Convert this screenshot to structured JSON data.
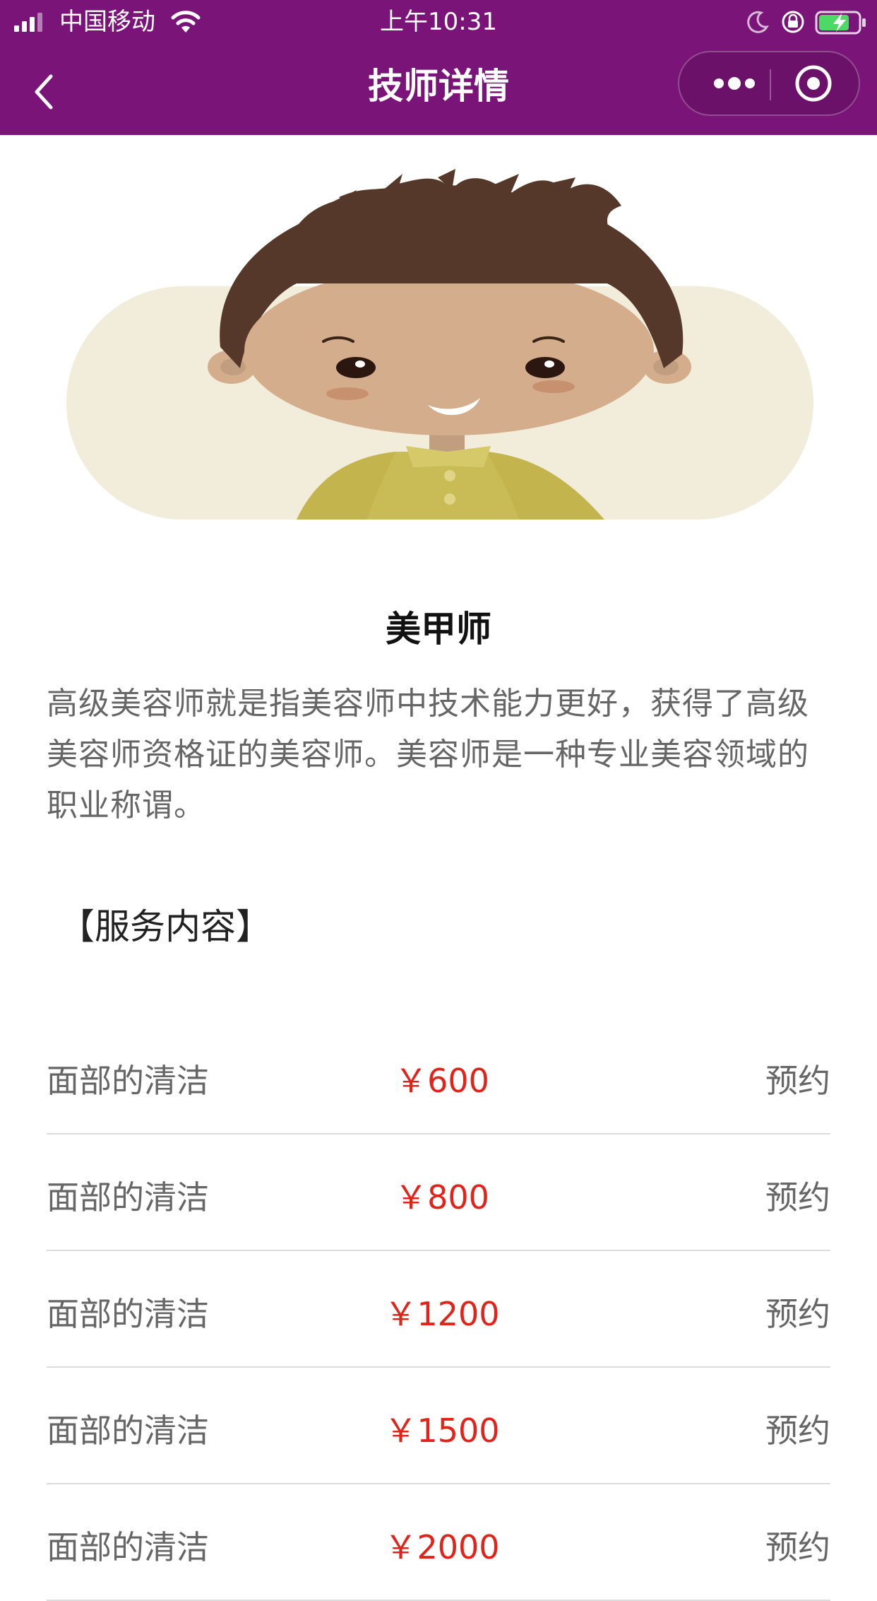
{
  "status_bar": {
    "carrier": "中国移动",
    "time": "上午10:31"
  },
  "nav": {
    "title": "技师详情"
  },
  "technician": {
    "title": "美甲师",
    "description": "高级美容师就是指美容师中技术能力更好，获得了高级美容师资格证的美容师。美容师是一种专业美容领域的职业称谓。"
  },
  "services_section": {
    "title": "【服务内容】",
    "items": [
      {
        "name": "面部的清洁",
        "price": "￥600",
        "action": "预约"
      },
      {
        "name": "面部的清洁",
        "price": "￥800",
        "action": "预约"
      },
      {
        "name": "面部的清洁",
        "price": "￥1200",
        "action": "预约"
      },
      {
        "name": "面部的清洁",
        "price": "￥1500",
        "action": "预约"
      },
      {
        "name": "面部的清洁",
        "price": "￥2000",
        "action": "预约"
      }
    ]
  },
  "colors": {
    "header_bg": "#7b1479",
    "price": "#e2231a",
    "text_secondary": "#666666"
  },
  "icons": [
    "signal-icon",
    "wifi-icon",
    "moon-icon",
    "rotation-lock-icon",
    "battery-icon",
    "back-icon",
    "more-icon",
    "close-miniprogram-icon"
  ]
}
